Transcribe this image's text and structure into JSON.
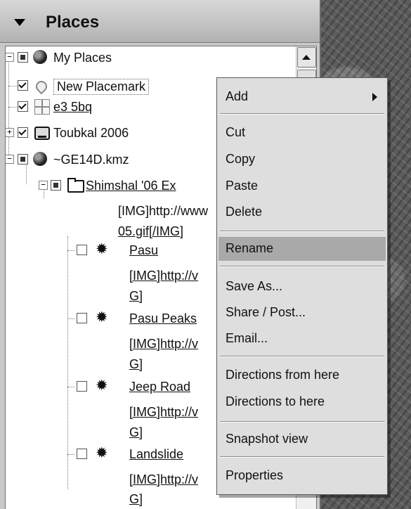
{
  "panel": {
    "title": "Places"
  },
  "tree": {
    "my_places": "My Places",
    "new_placemark": "New Placemark",
    "e3": "e3 5bq",
    "toubkal": "Toubkal 2006",
    "kmz": "~GE14D.kmz",
    "shimshal": "Shimshal '06 Ex",
    "shimshal_desc_1": "[IMG]http://www",
    "shimshal_desc_2": "05.gif[/IMG]",
    "items": [
      {
        "label": "Pasu",
        "desc_1": "[IMG]http://v",
        "desc_2": "G]"
      },
      {
        "label": "Pasu Peaks",
        "desc_1": "[IMG]http://v",
        "desc_2": "G]"
      },
      {
        "label": "Jeep Road",
        "desc_1": "[IMG]http://v",
        "desc_2": "G]"
      },
      {
        "label": "Landslide",
        "desc_1": "[IMG]http://v",
        "desc_2": "G]"
      }
    ]
  },
  "menu": {
    "add": "Add",
    "cut": "Cut",
    "copy": "Copy",
    "paste": "Paste",
    "delete": "Delete",
    "rename": "Rename",
    "save_as": "Save As...",
    "share_post": "Share / Post...",
    "email": "Email...",
    "directions_from": "Directions from here",
    "directions_to": "Directions to here",
    "snapshot_view": "Snapshot view",
    "properties": "Properties"
  }
}
